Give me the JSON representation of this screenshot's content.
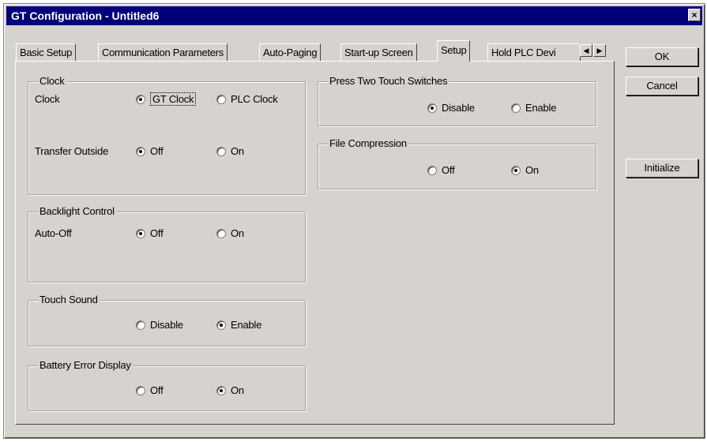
{
  "window": {
    "title": "GT Configuration - Untitled6",
    "close": "×"
  },
  "tabs": {
    "basic_setup": "Basic Setup",
    "communication_parameters": "Communication Parameters",
    "auto_paging": "Auto-Paging",
    "startup_screen": "Start-up Screen",
    "setup": "Setup",
    "hold_plc": "Hold PLC Devi",
    "scroll_left": "◀",
    "scroll_right": "▶",
    "active": "Setup"
  },
  "clock_group": {
    "title": "Clock",
    "clock_label": "Clock",
    "gt_clock": "GT Clock",
    "plc_clock": "PLC Clock",
    "clock_selected": "GT Clock",
    "transfer_label": "Transfer Outside",
    "transfer_off": "Off",
    "transfer_on": "On",
    "transfer_selected": "Off"
  },
  "backlight_group": {
    "title": "Backlight Control",
    "auto_off_label": "Auto-Off",
    "off": "Off",
    "on": "On",
    "selected": "Off"
  },
  "touch_sound_group": {
    "title": "Touch Sound",
    "disable": "Disable",
    "enable": "Enable",
    "selected": "Enable"
  },
  "battery_group": {
    "title": "Battery Error Display",
    "off": "Off",
    "on": "On",
    "selected": "On"
  },
  "press_two_group": {
    "title": "Press Two Touch Switches",
    "disable": "Disable",
    "enable": "Enable",
    "selected": "Disable"
  },
  "file_compression_group": {
    "title": "File Compression",
    "off": "Off",
    "on": "On",
    "selected": "On"
  },
  "buttons": {
    "ok": "OK",
    "cancel": "Cancel",
    "initialize": "Initialize"
  }
}
